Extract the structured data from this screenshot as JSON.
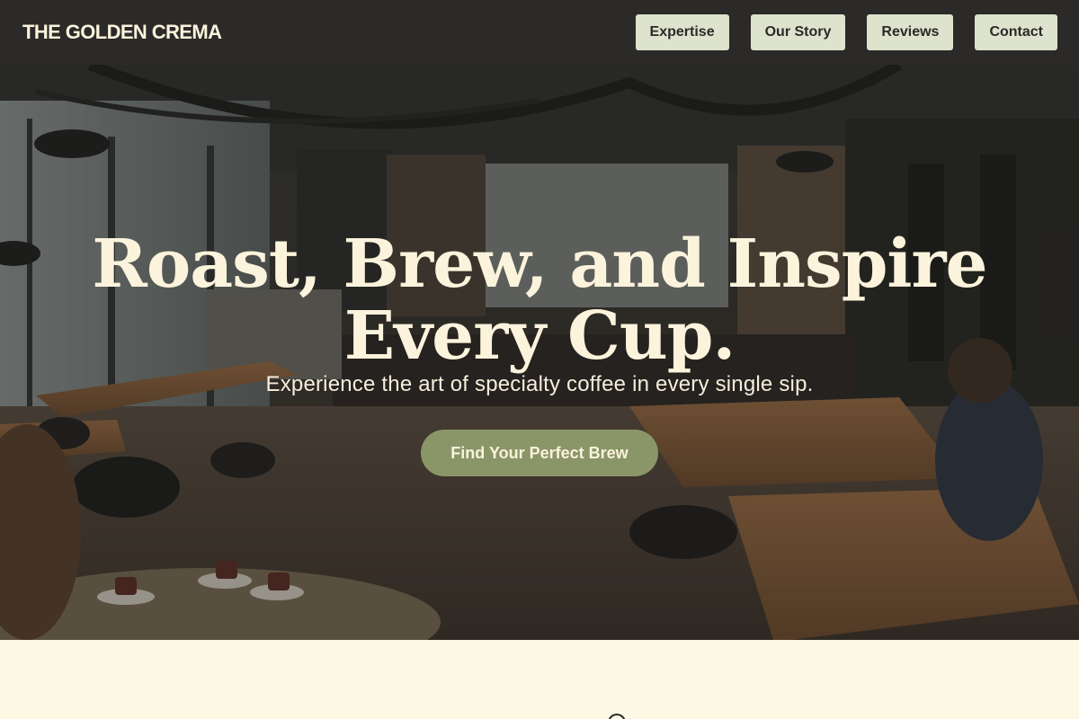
{
  "header": {
    "brand": "THE GOLDEN CREMA",
    "nav": [
      "Expertise",
      "Our Story",
      "Reviews",
      "Contact"
    ]
  },
  "hero": {
    "title": "Roast, Brew, and Inspire Every Cup.",
    "subtitle": "Experience the art of specialty coffee in every single sip.",
    "cta": "Find Your Perfect Brew"
  },
  "colors": {
    "header_bg": "#2b2a29",
    "nav_button_bg": "#dde3cc",
    "cta_bg": "#8a9668",
    "title_text": "#fbf3dc",
    "section_bg": "#fdf8e3"
  }
}
